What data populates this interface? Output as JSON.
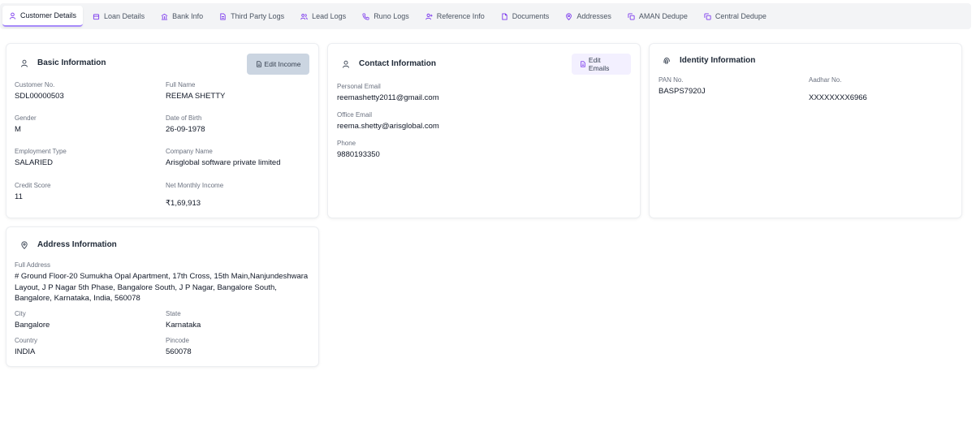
{
  "tabs": [
    {
      "label": "Customer Details",
      "icon": "user-icon",
      "active": true
    },
    {
      "label": "Loan Details",
      "icon": "bank-icon"
    },
    {
      "label": "Bank Info",
      "icon": "bank-building-icon"
    },
    {
      "label": "Third Party Logs",
      "icon": "file-icon"
    },
    {
      "label": "Lead Logs",
      "icon": "users-icon"
    },
    {
      "label": "Runo Logs",
      "icon": "phone-icon"
    },
    {
      "label": "Reference Info",
      "icon": "user-plus-icon"
    },
    {
      "label": "Documents",
      "icon": "document-icon"
    },
    {
      "label": "Addresses",
      "icon": "map-pin-icon"
    },
    {
      "label": "AMAN Dedupe",
      "icon": "copy-icon"
    },
    {
      "label": "Central Dedupe",
      "icon": "copy-icon"
    }
  ],
  "basic": {
    "title": "Basic Information",
    "edit_label": "Edit Income",
    "customer_no_label": "Customer No.",
    "customer_no": "SDL00000503",
    "full_name_label": "Full Name",
    "full_name": "REEMA SHETTY",
    "gender_label": "Gender",
    "gender": "M",
    "dob_label": "Date of Birth",
    "dob": "26-09-1978",
    "employment_label": "Employment Type",
    "employment": "SALARIED",
    "company_label": "Company Name",
    "company": "Arisglobal software private limited",
    "credit_label": "Credit Score",
    "credit": "11",
    "income_label": "Net Monthly Income",
    "income": "₹1,69,913"
  },
  "contact": {
    "title": "Contact Information",
    "edit_label": "Edit Emails",
    "personal_email_label": "Personal Email",
    "personal_email": "reemashetty2011@gmail.com",
    "office_email_label": "Office Email",
    "office_email": "reema.shetty@arisglobal.com",
    "phone_label": "Phone",
    "phone": "9880193350"
  },
  "identity": {
    "title": "Identity Information",
    "pan_label": "PAN No.",
    "pan": "BASPS7920J",
    "aadhar_label": "Aadhar No.",
    "aadhar": "XXXXXXXX6966"
  },
  "address": {
    "title": "Address Information",
    "full_label": "Full Address",
    "full": "# Ground Floor-20 Sumukha Opal Apartment, 17th Cross, 15th Main,Nanjundeshwara Layout, J P Nagar 5th Phase, Bangalore South, J P Nagar, Bangalore South, Bangalore, Karnataka, India, 560078",
    "city_label": "City",
    "city": "Bangalore",
    "state_label": "State",
    "state": "Karnataka",
    "country_label": "Country",
    "country": "INDIA",
    "pincode_label": "Pincode",
    "pincode": "560078"
  },
  "colors": {
    "accent": "#7c3aed",
    "tabbar_bg": "#f3f4f6",
    "income_btn_bg": "#cbd5e1",
    "emails_btn_bg": "#f3f0ff"
  }
}
